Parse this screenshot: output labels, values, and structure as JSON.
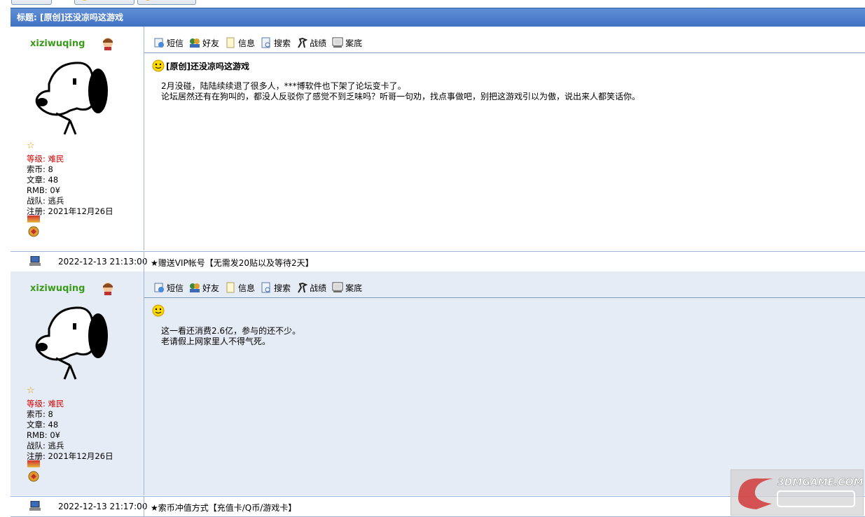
{
  "thread": {
    "title": "标题: [原创]还没凉吗这游戏"
  },
  "toolbar_labels": {
    "sms": "短信",
    "friend": "好友",
    "info": "信息",
    "search": "搜索",
    "record": "战绩",
    "bottom": "案底"
  },
  "posts": [
    {
      "username": "xiziwuqing",
      "level_label": "等级: 难民",
      "coins": "索币: 8",
      "articles": "文章: 48",
      "rmb": "RMB: 0¥",
      "team": "战队: 逃兵",
      "registered": "注册: 2021年12月26日",
      "title": "[原创]还没凉吗这游戏",
      "body_line1": "2月没碰，陆陆续续退了很多人，***博软件也下架了论坛变卡了。",
      "body_line2": "论坛居然还有在狗叫的，都没人反驳你了感觉不到乏味吗？听哥一句劝，找点事做吧，别把这游戏引以为傲，说出来人都笑话你。",
      "date": "2022-12-13 21:13:00",
      "ad": "★赠送VIP帐号【无需发20贴以及等待2天】"
    },
    {
      "username": "xiziwuqing",
      "level_label": "等级: 难民",
      "coins": "索币: 8",
      "articles": "文章: 48",
      "rmb": "RMB: 0¥",
      "team": "战队: 逃兵",
      "registered": "注册: 2021年12月26日",
      "title": "",
      "body_line1": "这一看还消费2.6亿，参与的还不少。",
      "body_line2": "老请假上网家里人不得气死。",
      "date": "2022-12-13 21:17:00",
      "ad": "★索币冲值方式【充值卡/Q币/游戏卡】"
    }
  ],
  "watermark": {
    "text": "3DMGAME.COM"
  },
  "colors": {
    "title_bar": "#4a7cc9",
    "username": "#3a9a1a",
    "level": "#d00000",
    "post_bg_alt": "#e6ecf5"
  }
}
